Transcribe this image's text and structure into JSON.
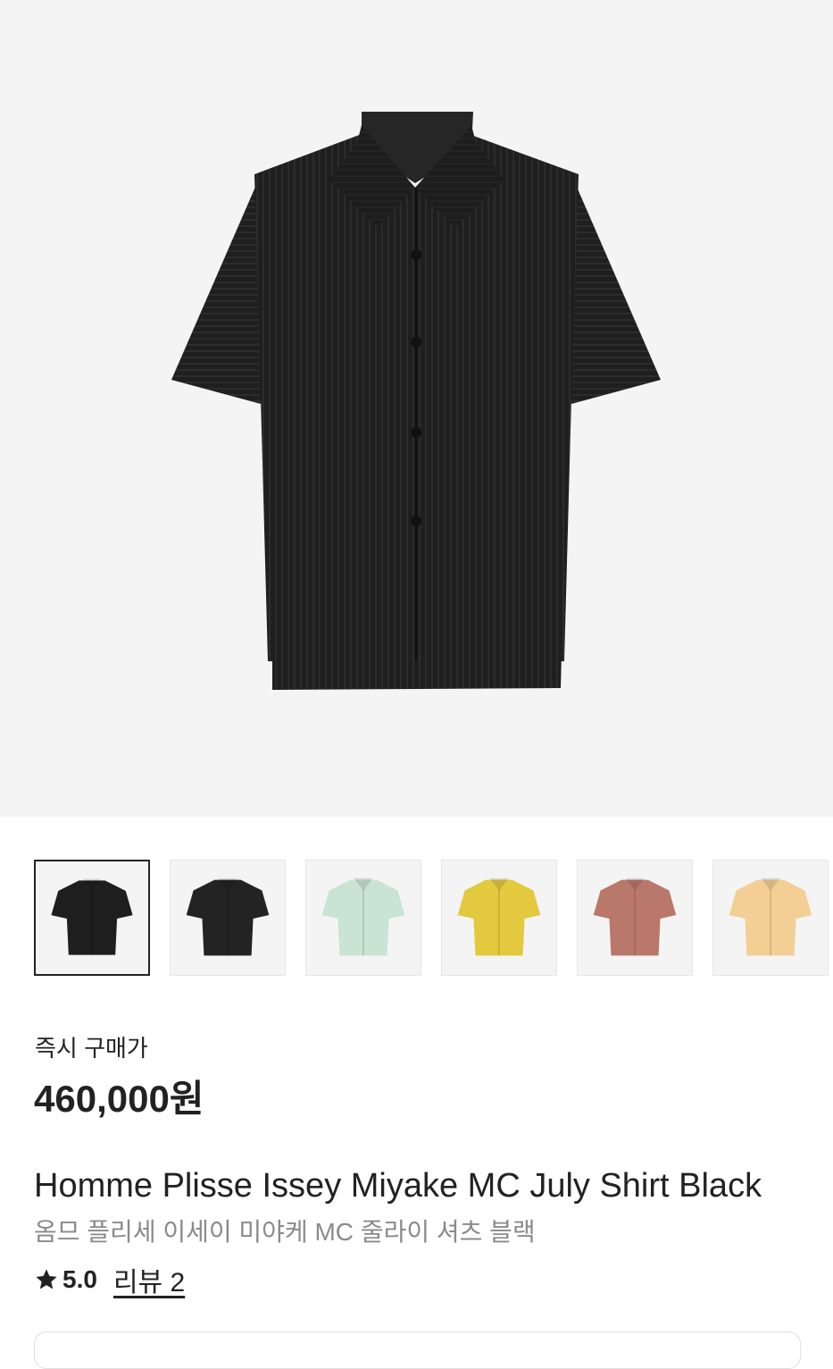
{
  "product": {
    "main_image_icon": "shirt-image",
    "price_label": "즉시 구매가",
    "price": "460,000원",
    "name_en": "Homme Plisse Issey Miyake MC July Shirt Black",
    "name_ko": "옴므 플리세 이세이 미야케 MC 줄라이 셔츠 블랙",
    "rating": "5.0",
    "review_link": "리뷰 2"
  },
  "thumbnails": [
    {
      "color": "#1e1e1e",
      "selected": true
    },
    {
      "color": "#232323",
      "selected": false
    },
    {
      "color": "#c9e4d3",
      "selected": false
    },
    {
      "color": "#e3c93e",
      "selected": false
    },
    {
      "color": "#b9786a",
      "selected": false
    },
    {
      "color": "#f4cf95",
      "selected": false
    }
  ],
  "colors": {
    "hero_bg": "#f4f4f4",
    "shirt_main": "#202020",
    "text_primary": "#222222",
    "text_secondary": "#8a8a8a"
  }
}
